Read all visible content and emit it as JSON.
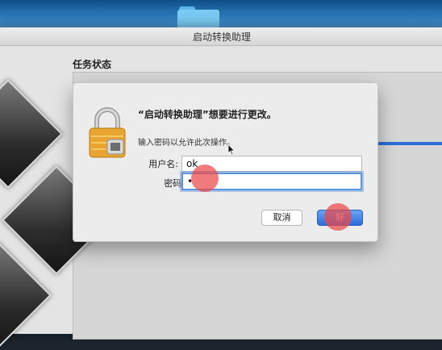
{
  "window": {
    "title": "启动转换助理"
  },
  "task": {
    "title": "任务状态"
  },
  "dialog": {
    "heading": "“启动转换助理”想要进行更改。",
    "prompt": "输入密码以允许此次操作。",
    "username_label": "用户名:",
    "username_value": "ok",
    "password_label": "密码:",
    "password_mask": "•",
    "cancel_label": "取消",
    "ok_label": "好"
  },
  "icons": {
    "lock": "lock-icon",
    "folder": "folder-icon",
    "cursor": "mouse-pointer-icon"
  },
  "colors": {
    "accent": "#2c6bdb",
    "tap_marker": "#eb4646",
    "desktop": "#2f7fc0"
  }
}
